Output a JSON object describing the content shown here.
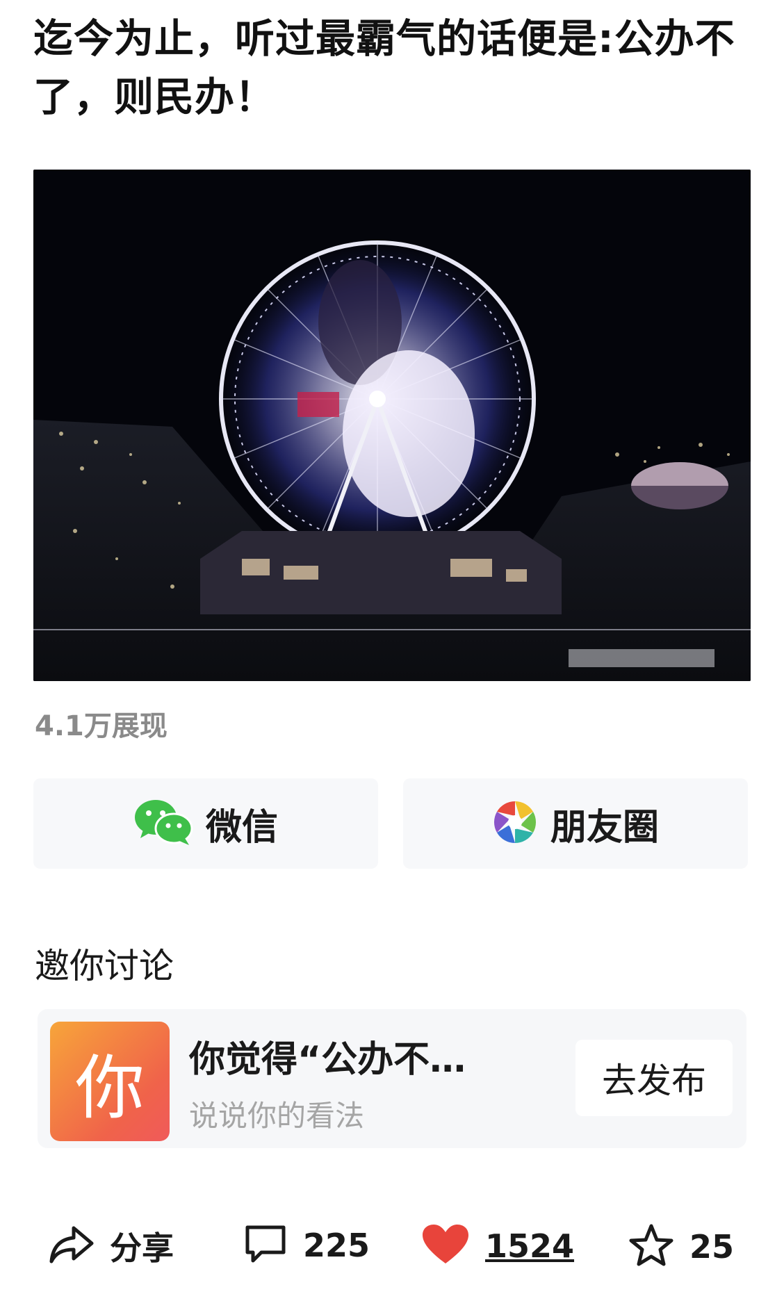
{
  "post": {
    "title": "迄今为止，听过最霸气的话便是:公办不了，则民办！",
    "views": "4.1万展现"
  },
  "share": {
    "wechat_label": "微信",
    "moments_label": "朋友圈"
  },
  "discussion": {
    "heading": "邀你讨论",
    "avatar_char": "你",
    "topic": "你觉得“公办不…",
    "hint": "说说你的看法",
    "publish_label": "去发布"
  },
  "actions": {
    "share_label": "分享",
    "comments": "225",
    "likes": "1524",
    "favorites": "25"
  },
  "icons": [
    "wechat-icon",
    "moments-icon",
    "share-icon",
    "comment-icon",
    "heart-icon",
    "star-icon"
  ],
  "colors": {
    "like": "#e8443b",
    "wechat": "#3fbf4a"
  }
}
